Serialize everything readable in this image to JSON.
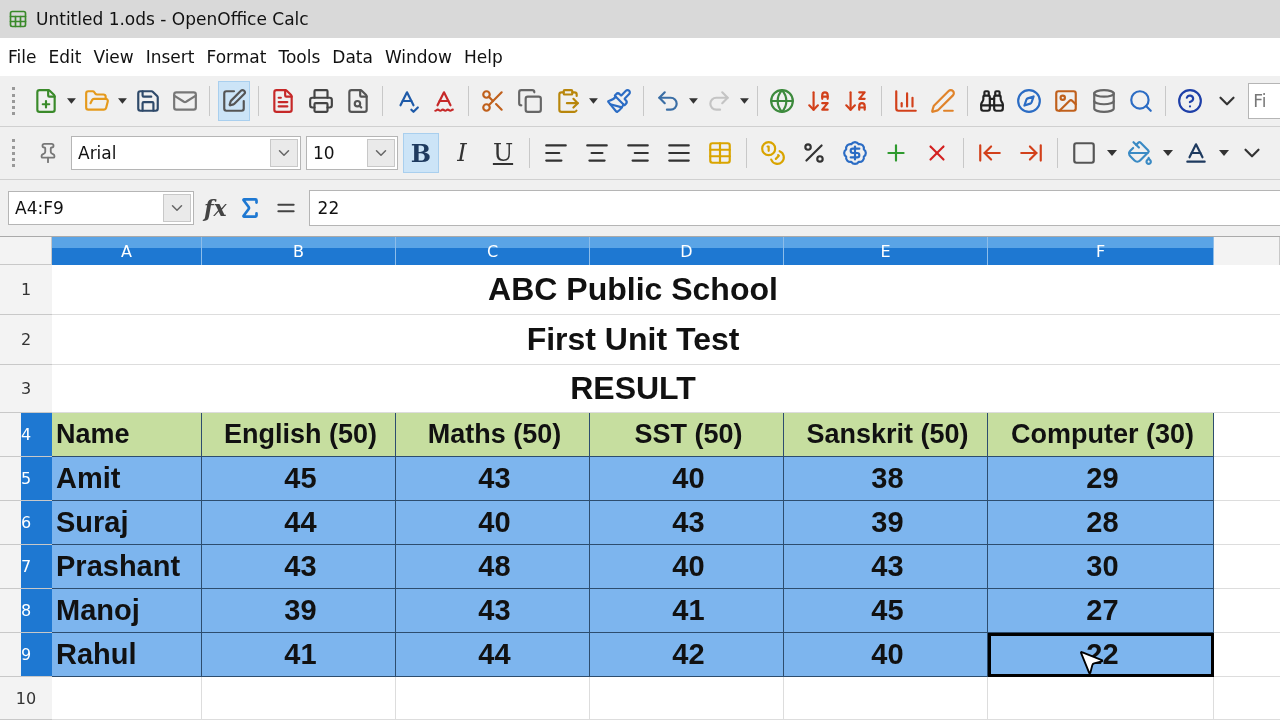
{
  "window": {
    "title": "Untitled 1.ods - OpenOffice Calc"
  },
  "menu": [
    "File",
    "Edit",
    "View",
    "Insert",
    "Format",
    "Tools",
    "Data",
    "Window",
    "Help"
  ],
  "standard_toolbar": {
    "edit_file_on": true,
    "redo_disabled": true,
    "find_field_value": "Fi"
  },
  "formatting_toolbar": {
    "font": "Arial",
    "size": "10",
    "bold": {
      "label": "B",
      "on": true
    },
    "italic": {
      "label": "I",
      "on": false
    },
    "underline": {
      "label": "U",
      "on": false
    }
  },
  "formula_bar": {
    "name_box": "A4:F9",
    "function_wizard": "fx",
    "content": "22"
  },
  "sheet": {
    "columns": [
      {
        "label": "A",
        "selected": true
      },
      {
        "label": "B",
        "selected": true
      },
      {
        "label": "C",
        "selected": true
      },
      {
        "label": "D",
        "selected": true
      },
      {
        "label": "E",
        "selected": true
      },
      {
        "label": "F",
        "selected": true
      }
    ],
    "rows": [
      {
        "label": "1",
        "selected": false,
        "kind": "title",
        "title": "ABC Public School"
      },
      {
        "label": "2",
        "selected": false,
        "kind": "title",
        "title": "First Unit Test"
      },
      {
        "label": "3",
        "selected": false,
        "kind": "title",
        "title": "RESULT"
      },
      {
        "label": "4",
        "selected": true,
        "kind": "header",
        "cells": [
          {
            "text": "Name",
            "active": false
          },
          {
            "text": "English (50)",
            "active": false
          },
          {
            "text": "Maths (50)",
            "active": false
          },
          {
            "text": "SST (50)",
            "active": false
          },
          {
            "text": "Sanskrit (50)",
            "active": false
          },
          {
            "text": "Computer (30)",
            "active": false
          }
        ]
      },
      {
        "label": "5",
        "selected": true,
        "kind": "data",
        "cells": [
          {
            "text": "Amit",
            "active": false
          },
          {
            "text": "45",
            "active": false
          },
          {
            "text": "43",
            "active": false
          },
          {
            "text": "40",
            "active": false
          },
          {
            "text": "38",
            "active": false
          },
          {
            "text": "29",
            "active": false
          }
        ]
      },
      {
        "label": "6",
        "selected": true,
        "kind": "data",
        "cells": [
          {
            "text": "Suraj",
            "active": false
          },
          {
            "text": "44",
            "active": false
          },
          {
            "text": "40",
            "active": false
          },
          {
            "text": "43",
            "active": false
          },
          {
            "text": "39",
            "active": false
          },
          {
            "text": "28",
            "active": false
          }
        ]
      },
      {
        "label": "7",
        "selected": true,
        "kind": "data",
        "cells": [
          {
            "text": "Prashant",
            "active": false
          },
          {
            "text": "43",
            "active": false
          },
          {
            "text": "48",
            "active": false
          },
          {
            "text": "40",
            "active": false
          },
          {
            "text": "43",
            "active": false
          },
          {
            "text": "30",
            "active": false
          }
        ]
      },
      {
        "label": "8",
        "selected": true,
        "kind": "data",
        "cells": [
          {
            "text": "Manoj",
            "active": false
          },
          {
            "text": "39",
            "active": false
          },
          {
            "text": "43",
            "active": false
          },
          {
            "text": "41",
            "active": false
          },
          {
            "text": "45",
            "active": false
          },
          {
            "text": "27",
            "active": false
          }
        ]
      },
      {
        "label": "9",
        "selected": true,
        "kind": "data",
        "cells": [
          {
            "text": "Rahul",
            "active": false
          },
          {
            "text": "41",
            "active": false
          },
          {
            "text": "44",
            "active": false
          },
          {
            "text": "42",
            "active": false
          },
          {
            "text": "40",
            "active": false
          },
          {
            "text": "22",
            "active": true
          }
        ]
      },
      {
        "label": "10",
        "selected": false,
        "kind": "blank"
      }
    ]
  }
}
